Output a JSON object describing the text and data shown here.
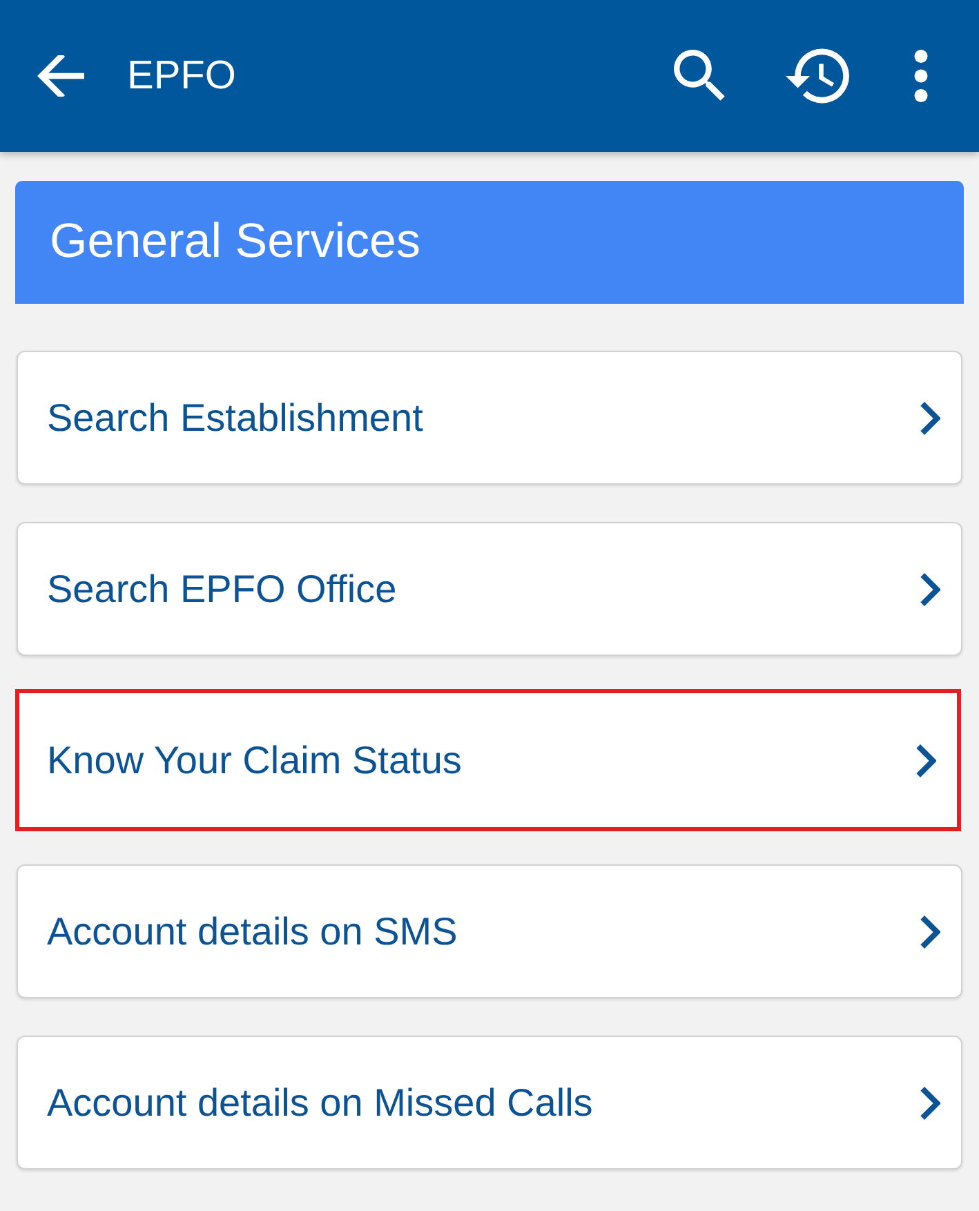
{
  "app_bar": {
    "title": "EPFO"
  },
  "section": {
    "title": "General Services"
  },
  "items": [
    {
      "label": "Search Establishment",
      "highlighted": false
    },
    {
      "label": "Search EPFO Office",
      "highlighted": false
    },
    {
      "label": "Know Your Claim Status",
      "highlighted": true
    },
    {
      "label": "Account details on SMS",
      "highlighted": false
    },
    {
      "label": "Account details on Missed Calls",
      "highlighted": false
    }
  ]
}
